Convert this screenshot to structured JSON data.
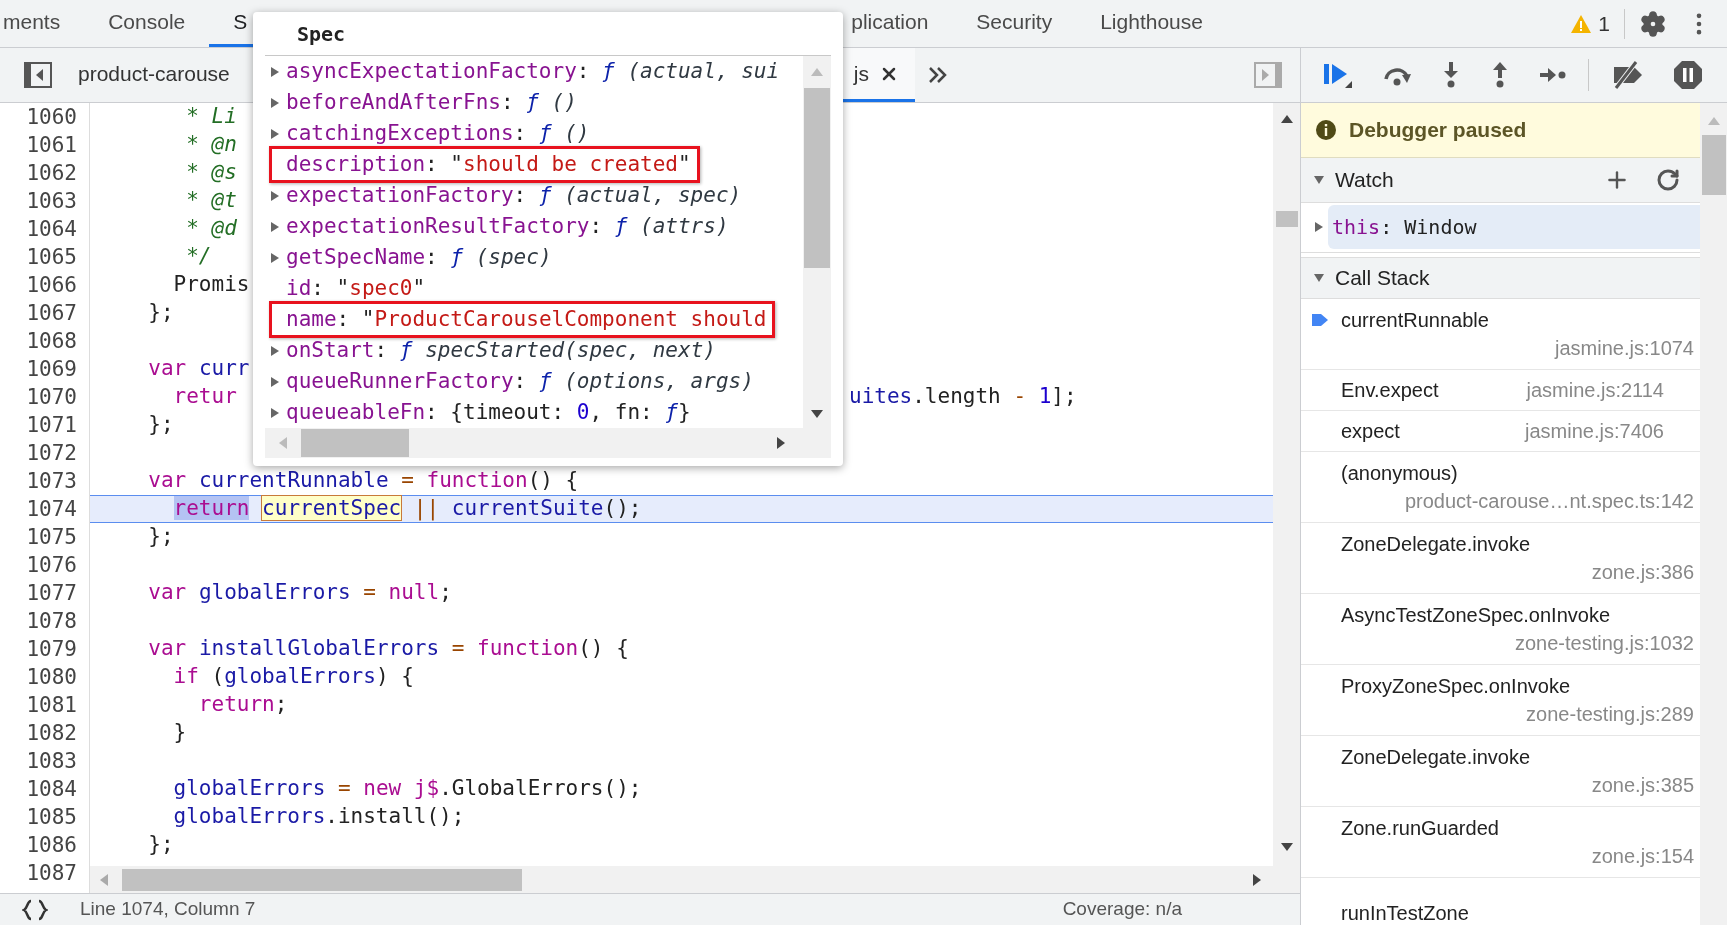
{
  "tabs": [
    {
      "label": "ments",
      "selected": false
    },
    {
      "label": "Console",
      "selected": false
    },
    {
      "label": "S",
      "selected": true
    },
    {
      "label": "plication",
      "selected": false,
      "after_popup": true
    },
    {
      "label": "Security",
      "selected": false
    },
    {
      "label": "Lighthouse",
      "selected": false
    }
  ],
  "issues_count": "1",
  "file_tabs": [
    {
      "label": "product-carouse",
      "selected": false,
      "closable": false
    },
    {
      "label": "js",
      "selected": true,
      "closable": true,
      "after_popup": true
    }
  ],
  "editor": {
    "lines": [
      {
        "number": "1060",
        "current": false,
        "tokens": [
          {
            "kind": "comment",
            "text": "     * Li"
          }
        ]
      },
      {
        "number": "1061",
        "current": false,
        "tokens": [
          {
            "kind": "comment",
            "text": "     * @n"
          }
        ]
      },
      {
        "number": "1062",
        "current": false,
        "tokens": [
          {
            "kind": "comment",
            "text": "     * @s"
          }
        ]
      },
      {
        "number": "1063",
        "current": false,
        "tokens": [
          {
            "kind": "comment",
            "text": "     * @t"
          }
        ]
      },
      {
        "number": "1064",
        "current": false,
        "tokens": [
          {
            "kind": "comment",
            "text": "     * @d"
          }
        ]
      },
      {
        "number": "1065",
        "current": false,
        "tokens": [
          {
            "kind": "comment",
            "text": "     */"
          }
        ]
      },
      {
        "number": "1066",
        "current": false,
        "tokens": [
          {
            "kind": "plain",
            "text": "    Promis"
          }
        ]
      },
      {
        "number": "1067",
        "current": false,
        "tokens": [
          {
            "kind": "plain",
            "text": "  };"
          }
        ]
      },
      {
        "number": "1068",
        "current": false
      },
      {
        "number": "1069",
        "current": false,
        "tokens": [
          {
            "kind": "keyword",
            "text": "  var"
          },
          {
            "kind": "variable",
            "text": " curr"
          }
        ]
      },
      {
        "number": "1070",
        "current": false,
        "tokens": [
          {
            "kind": "keyword",
            "text": "    retur"
          },
          {
            "kind": "variable",
            "text": "uites",
            "after_popup": true
          },
          {
            "kind": "plain",
            "text": ".length ",
            "after_popup": true
          },
          {
            "kind": "operator",
            "text": "-",
            "after_popup": true
          },
          {
            "kind": "number",
            "text": " 1",
            "after_popup": true
          },
          {
            "kind": "plain",
            "text": "];",
            "after_popup": true
          }
        ]
      },
      {
        "number": "1071",
        "current": false,
        "tokens": [
          {
            "kind": "plain",
            "text": "  };"
          }
        ]
      },
      {
        "number": "1072",
        "current": false
      },
      {
        "number": "1073",
        "current": false,
        "tokens": [
          {
            "kind": "keyword",
            "text": "  var"
          },
          {
            "kind": "variable",
            "text": " currentRunnable"
          },
          {
            "kind": "operator",
            "text": " = "
          },
          {
            "kind": "keyword",
            "text": "function"
          },
          {
            "kind": "plain",
            "text": "() {"
          }
        ]
      },
      {
        "number": "1074",
        "current": true,
        "tokens": [
          {
            "kind": "keyword",
            "text": "    return",
            "selected": true,
            "hovered": false
          },
          {
            "kind": "variable",
            "text": " currentSpec",
            "selected": false,
            "hovered": true
          },
          {
            "kind": "operator",
            "text": " || ",
            "selected": false,
            "hovered": false
          },
          {
            "kind": "variable",
            "text": "currentSuite",
            "selected": false,
            "hovered": false
          },
          {
            "kind": "plain",
            "text": "();",
            "selected": false,
            "hovered": false
          }
        ]
      },
      {
        "number": "1075",
        "current": false,
        "tokens": [
          {
            "kind": "plain",
            "text": "  };"
          }
        ]
      },
      {
        "number": "1076",
        "current": false
      },
      {
        "number": "1077",
        "current": false,
        "tokens": [
          {
            "kind": "keyword",
            "text": "  var"
          },
          {
            "kind": "variable",
            "text": " globalErrors"
          },
          {
            "kind": "operator",
            "text": " = "
          },
          {
            "kind": "keyword",
            "text": "null"
          },
          {
            "kind": "plain",
            "text": ";"
          }
        ]
      },
      {
        "number": "1078",
        "current": false
      },
      {
        "number": "1079",
        "current": false,
        "tokens": [
          {
            "kind": "keyword",
            "text": "  var"
          },
          {
            "kind": "variable",
            "text": " installGlobalErrors"
          },
          {
            "kind": "operator",
            "text": " = "
          },
          {
            "kind": "keyword",
            "text": "function"
          },
          {
            "kind": "plain",
            "text": "() {"
          }
        ]
      },
      {
        "number": "1080",
        "current": false,
        "tokens": [
          {
            "kind": "keyword",
            "text": "    if"
          },
          {
            "kind": "plain",
            "text": " ("
          },
          {
            "kind": "variable",
            "text": "globalErrors"
          },
          {
            "kind": "plain",
            "text": ") {"
          }
        ]
      },
      {
        "number": "1081",
        "current": false,
        "tokens": [
          {
            "kind": "keyword",
            "text": "      return"
          },
          {
            "kind": "plain",
            "text": ";"
          }
        ]
      },
      {
        "number": "1082",
        "current": false,
        "tokens": [
          {
            "kind": "plain",
            "text": "    }"
          }
        ]
      },
      {
        "number": "1083",
        "current": false
      },
      {
        "number": "1084",
        "current": false,
        "tokens": [
          {
            "kind": "variable",
            "text": "    globalErrors"
          },
          {
            "kind": "operator",
            "text": " = "
          },
          {
            "kind": "keyword",
            "text": "new"
          },
          {
            "kind": "keyword",
            "text": " j$"
          },
          {
            "kind": "plain",
            "text": ".GlobalErrors();"
          }
        ]
      },
      {
        "number": "1085",
        "current": false,
        "tokens": [
          {
            "kind": "variable",
            "text": "    globalErrors"
          },
          {
            "kind": "plain",
            "text": ".install();"
          }
        ]
      },
      {
        "number": "1086",
        "current": false,
        "tokens": [
          {
            "kind": "plain",
            "text": "  };"
          }
        ]
      },
      {
        "number": "1087",
        "current": false
      }
    ]
  },
  "popover": {
    "title": "Spec",
    "properties": [
      {
        "key": "asyncExpectationFactory",
        "expandable": true,
        "boxed": false,
        "value": [
          {
            "kind": "plain",
            "text": ": "
          },
          {
            "kind": "func",
            "text": "ƒ"
          },
          {
            "kind": "italic",
            "text": " (actual, sui"
          }
        ]
      },
      {
        "key": "beforeAndAfterFns",
        "expandable": true,
        "boxed": false,
        "value": [
          {
            "kind": "plain",
            "text": ": "
          },
          {
            "kind": "func",
            "text": "ƒ"
          },
          {
            "kind": "italic",
            "text": " ()"
          }
        ]
      },
      {
        "key": "catchingExceptions",
        "expandable": true,
        "boxed": false,
        "value": [
          {
            "kind": "plain",
            "text": ": "
          },
          {
            "kind": "func",
            "text": "ƒ"
          },
          {
            "kind": "italic",
            "text": " ()"
          }
        ]
      },
      {
        "key": "description",
        "expandable": false,
        "boxed": true,
        "value": [
          {
            "kind": "plain",
            "text": ": \""
          },
          {
            "kind": "string",
            "text": "should be created"
          },
          {
            "kind": "plain",
            "text": "\""
          }
        ]
      },
      {
        "key": "expectationFactory",
        "expandable": true,
        "boxed": false,
        "value": [
          {
            "kind": "plain",
            "text": ": "
          },
          {
            "kind": "func",
            "text": "ƒ"
          },
          {
            "kind": "italic",
            "text": " (actual, spec)"
          }
        ]
      },
      {
        "key": "expectationResultFactory",
        "expandable": true,
        "boxed": false,
        "value": [
          {
            "kind": "plain",
            "text": ": "
          },
          {
            "kind": "func",
            "text": "ƒ"
          },
          {
            "kind": "italic",
            "text": " (attrs)"
          }
        ]
      },
      {
        "key": "getSpecName",
        "expandable": true,
        "boxed": false,
        "value": [
          {
            "kind": "plain",
            "text": ": "
          },
          {
            "kind": "func",
            "text": "ƒ"
          },
          {
            "kind": "italic",
            "text": " (spec)"
          }
        ]
      },
      {
        "key": "id",
        "expandable": false,
        "boxed": false,
        "value": [
          {
            "kind": "plain",
            "text": ": \""
          },
          {
            "kind": "string",
            "text": "spec0"
          },
          {
            "kind": "plain",
            "text": "\""
          }
        ]
      },
      {
        "key": "name",
        "expandable": false,
        "boxed": true,
        "value": [
          {
            "kind": "plain",
            "text": ": \""
          },
          {
            "kind": "string",
            "text": "ProductCarouselComponent should"
          }
        ]
      },
      {
        "key": "onStart",
        "expandable": true,
        "boxed": false,
        "value": [
          {
            "kind": "plain",
            "text": ": "
          },
          {
            "kind": "func",
            "text": "ƒ"
          },
          {
            "kind": "italic",
            "text": " specStarted(spec, next)"
          }
        ]
      },
      {
        "key": "queueRunnerFactory",
        "expandable": true,
        "boxed": false,
        "value": [
          {
            "kind": "plain",
            "text": ": "
          },
          {
            "kind": "func",
            "text": "ƒ"
          },
          {
            "kind": "italic",
            "text": " (options, args)"
          }
        ]
      },
      {
        "key": "queueableFn",
        "expandable": true,
        "boxed": false,
        "value": [
          {
            "kind": "plain",
            "text": ": {timeout: "
          },
          {
            "kind": "number",
            "text": "0"
          },
          {
            "kind": "plain",
            "text": ", fn: "
          },
          {
            "kind": "func",
            "text": "ƒ"
          },
          {
            "kind": "plain",
            "text": "}"
          }
        ]
      }
    ]
  },
  "status_bar": {
    "position": "Line 1074, Column 7",
    "coverage": "Coverage: n/a"
  },
  "debugger": {
    "banner": "Debugger paused",
    "watch": {
      "title": "Watch",
      "expanded": true,
      "items": [
        {
          "name": "this",
          "value": ": Window",
          "expanded": false
        }
      ]
    },
    "call_stack": {
      "title": "Call Stack",
      "expanded": true,
      "frames": [
        {
          "kind": "stacked",
          "name": "currentRunnable",
          "location": "jasmine.js:1074",
          "current": true
        },
        {
          "kind": "inline",
          "name": "Env.expect",
          "location": "jasmine.js:2114",
          "current": false
        },
        {
          "kind": "inline",
          "name": "expect",
          "location": "jasmine.js:7406",
          "current": false
        },
        {
          "kind": "stacked",
          "name": "(anonymous)",
          "location": "product-carouse…nt.spec.ts:142",
          "current": false
        },
        {
          "kind": "stacked",
          "name": "ZoneDelegate.invoke",
          "location": "zone.js:386",
          "current": false
        },
        {
          "kind": "stacked",
          "name": "AsyncTestZoneSpec.onInvoke",
          "location": "zone-testing.js:1032",
          "current": false
        },
        {
          "kind": "stacked",
          "name": "ProxyZoneSpec.onInvoke",
          "location": "zone-testing.js:289",
          "current": false
        },
        {
          "kind": "stacked",
          "name": "ZoneDelegate.invoke",
          "location": "zone.js:385",
          "current": false
        },
        {
          "kind": "stacked",
          "name": "Zone.runGuarded",
          "location": "zone.js:154",
          "current": false
        },
        {
          "kind": "stacked",
          "name": "runInTestZone",
          "current": false
        }
      ]
    }
  }
}
